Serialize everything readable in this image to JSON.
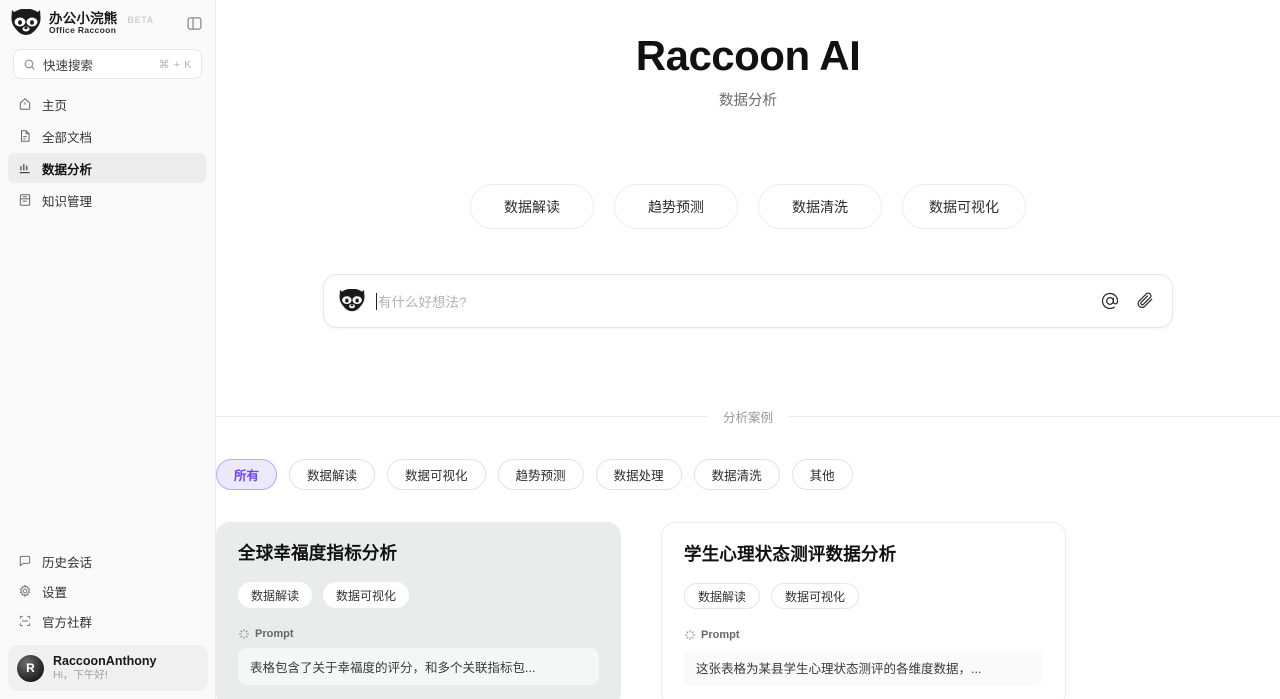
{
  "sidebar": {
    "brand": {
      "name_cn": "办公小浣熊",
      "name_en": "Office Raccoon",
      "badge": "BETA"
    },
    "panel_toggle_name": "sidebar-toggle",
    "search": {
      "placeholder": "快速搜索",
      "shortcut": "⌘ + K"
    },
    "nav": [
      {
        "label": "主页",
        "icon": "home-icon",
        "active": false
      },
      {
        "label": "全部文档",
        "icon": "document-icon",
        "active": false
      },
      {
        "label": "数据分析",
        "icon": "bar-chart-icon",
        "active": true
      },
      {
        "label": "知识管理",
        "icon": "knowledge-book-icon",
        "active": false
      }
    ],
    "bottom_nav": [
      {
        "label": "历史会话",
        "icon": "chat-history-icon"
      },
      {
        "label": "设置",
        "icon": "gear-icon"
      },
      {
        "label": "官方社群",
        "icon": "community-scan-icon"
      }
    ],
    "profile": {
      "initial": "R",
      "name": "RaccoonAnthony",
      "greeting": "Hi，下午好!"
    }
  },
  "hero": {
    "title": "Raccoon AI",
    "subtitle": "数据分析"
  },
  "quick_actions": [
    "数据解读",
    "趋势预测",
    "数据清洗",
    "数据可视化"
  ],
  "composer": {
    "placeholder": "有什么好想法?",
    "value": "",
    "mention_icon": "at-icon",
    "attach_icon": "paperclip-icon"
  },
  "examples": {
    "section_label": "分析案例",
    "filters": [
      {
        "label": "所有",
        "active": true
      },
      {
        "label": "数据解读",
        "active": false
      },
      {
        "label": "数据可视化",
        "active": false
      },
      {
        "label": "趋势预测",
        "active": false
      },
      {
        "label": "数据处理",
        "active": false
      },
      {
        "label": "数据清洗",
        "active": false
      },
      {
        "label": "其他",
        "active": false
      }
    ],
    "cards": [
      {
        "title": "全球幸福度指标分析",
        "tags": [
          "数据解读",
          "数据可视化"
        ],
        "prompt_label": "Prompt",
        "prompt_text": "表格包含了关于幸福度的评分，和多个关联指标包..."
      },
      {
        "title": "学生心理状态测评数据分析",
        "tags": [
          "数据解读",
          "数据可视化"
        ],
        "prompt_label": "Prompt",
        "prompt_text": "这张表格为某县学生心理状态测评的各维度数据，..."
      }
    ]
  },
  "colors": {
    "accent_purple": "#6d45f5",
    "accent_purple_bg": "#ece9fd",
    "sidebar_bg": "#fafafa",
    "card_tinted_bg": "#e8eceb"
  }
}
